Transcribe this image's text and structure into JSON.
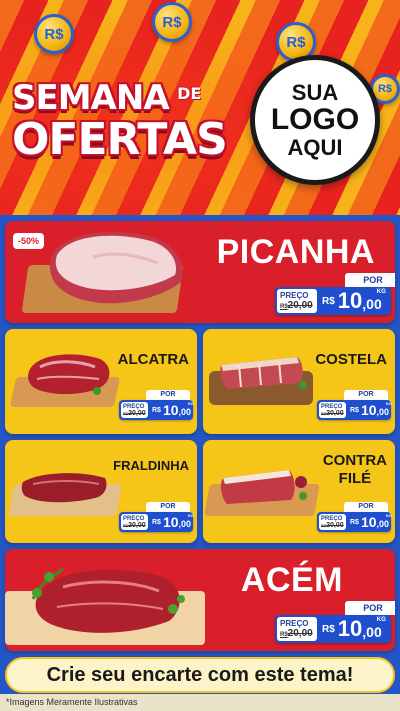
{
  "header": {
    "coin_label": "R$",
    "title_line1": "SEMANA",
    "title_de": "DE",
    "title_line2": "OFERTAS",
    "logo": {
      "line1": "SUA",
      "line2": "LOGO",
      "line3": "AQUI"
    }
  },
  "colors": {
    "red": "#d9202a",
    "yellow": "#f5c518",
    "blue": "#1f4fcf",
    "orange": "#f26a1a"
  },
  "products": {
    "picanha": {
      "name": "PICANHA",
      "discount": "-50%",
      "por": "POR",
      "preco_label": "PREÇO",
      "old_cur": "R$",
      "old_price": "20,00",
      "cur": "R$",
      "int": "10",
      "dec": ",00",
      "unit": "KG"
    },
    "alcatra": {
      "name": "ALCATRA",
      "por": "POR",
      "preco_label": "PREÇO",
      "old_cur": "R$",
      "old_price": "20,00",
      "cur": "R$",
      "int": "10",
      "dec": ",00",
      "unit": "KG"
    },
    "costela": {
      "name": "COSTELA",
      "por": "POR",
      "preco_label": "PREÇO",
      "old_cur": "R$",
      "old_price": "20,00",
      "cur": "R$",
      "int": "10",
      "dec": ",00",
      "unit": "KG"
    },
    "fraldinha": {
      "name": "FRALDINHA",
      "por": "POR",
      "preco_label": "PREÇO",
      "old_cur": "R$",
      "old_price": "20,00",
      "cur": "R$",
      "int": "10",
      "dec": ",00",
      "unit": "KG"
    },
    "contrafile": {
      "name_line1": "CONTRA",
      "name_line2": "FILÉ",
      "por": "POR",
      "preco_label": "PREÇO",
      "old_cur": "R$",
      "old_price": "20,00",
      "cur": "R$",
      "int": "10",
      "dec": ",00",
      "unit": "KG"
    },
    "acem": {
      "name": "ACÉM",
      "por": "POR",
      "preco_label": "PREÇO",
      "old_cur": "R$",
      "old_price": "20,00",
      "cur": "R$",
      "int": "10",
      "dec": ",00",
      "unit": "KG"
    }
  },
  "banner": {
    "text": "Crie seu encarte com este tema!"
  },
  "footer": {
    "disclaimer": "*Imagens Meramente Ilustrativas"
  }
}
